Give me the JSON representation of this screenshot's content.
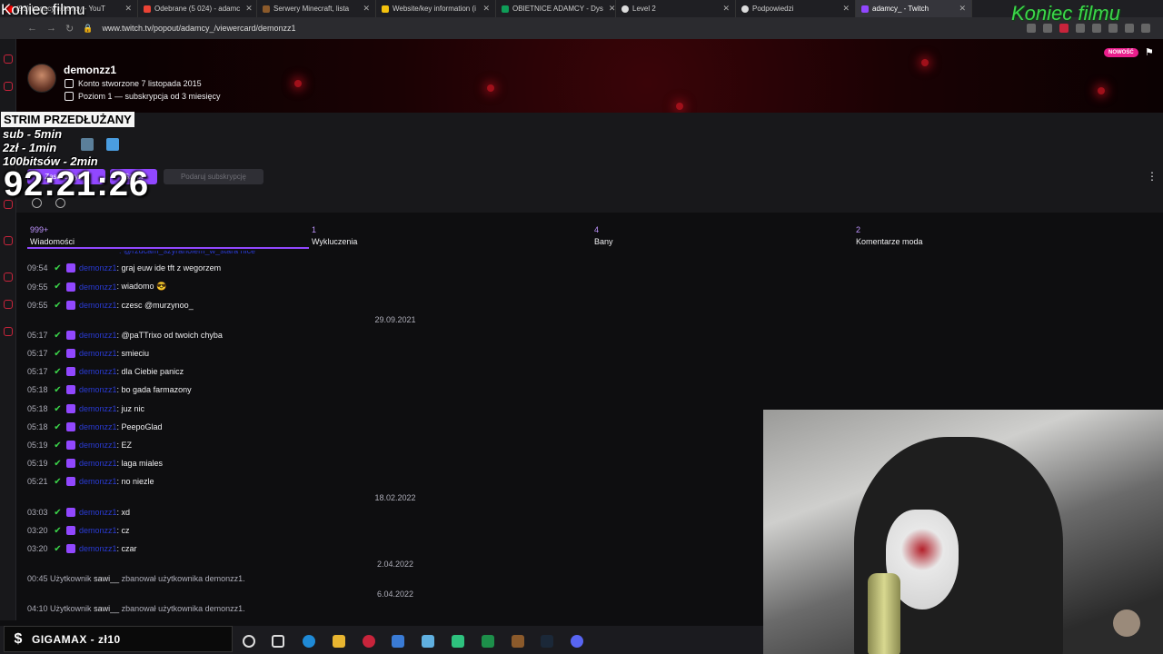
{
  "browser": {
    "tabs": [
      {
        "label": "(92) Legacy adamcy - YouT",
        "color": "#ff0000"
      },
      {
        "label": "Odebrane (5 024) - adamc",
        "color": "#ea4335"
      },
      {
        "label": "Serwery Minecraft, lista",
        "color": "#8b5a2b"
      },
      {
        "label": "Website/key information (i",
        "color": "#f4c20d"
      },
      {
        "label": "OBIETNICE ADAMCY - Dys",
        "color": "#0f9d58"
      },
      {
        "label": "Level 2",
        "color": "#dddddd"
      },
      {
        "label": "Podpowiedzi",
        "color": "#dddddd"
      },
      {
        "label": "adamcy_ - Twitch",
        "color": "#9147ff"
      }
    ],
    "url": "www.twitch.tv/popout/adamcy_/viewercard/demonzz1"
  },
  "overlay": {
    "koniec_left": "Koniec filmu",
    "koniec_right": "Koniec filmu",
    "strim": "STRIM PRZEDŁUŻANY",
    "line1": "sub - 5min",
    "line2": "2zł - 1min",
    "line3": "100bitsów - 2min",
    "timer": "92:21:26"
  },
  "viewer": {
    "username": "demonzz1",
    "account_created": "Konto stworzone 7 listopada 2015",
    "sub_info": "Poziom 1 — subskrypcja od 3 miesięcy",
    "new_badge": "NOWOŚĆ"
  },
  "actions": {
    "follow_label": "Zasubskrybuj",
    "sub_label": "Szept",
    "gift_label": "Podaruj subskrypcję"
  },
  "stats": [
    {
      "num": "999+",
      "label": "Wiadomości"
    },
    {
      "num": "1",
      "label": "Wykluczenia"
    },
    {
      "num": "4",
      "label": "Bany"
    },
    {
      "num": "2",
      "label": "Komentarze moda"
    }
  ],
  "chat": {
    "cut_top": ": @rzucam_szyranolem_w_stara nice",
    "username_hidden": "demonzz1",
    "group1": [
      {
        "time": "09:54",
        "text": ": graj euw ide tft z wegorzem"
      },
      {
        "time": "09:55",
        "text": ": wiadomo 😎"
      },
      {
        "time": "09:55",
        "text": ": czesc @murzynoo_"
      }
    ],
    "date1": "29.09.2021",
    "group2": [
      {
        "time": "05:17",
        "text": ": @paTTrixo od twoich chyba"
      },
      {
        "time": "05:17",
        "text": ": smieciu"
      },
      {
        "time": "05:17",
        "text": ": dla Ciebie panicz"
      },
      {
        "time": "05:18",
        "text": ": bo gada farmazony"
      },
      {
        "time": "05:18",
        "text": ": juz nic"
      },
      {
        "time": "05:18",
        "text": ": PeepoGlad"
      },
      {
        "time": "05:19",
        "text": ": EZ"
      },
      {
        "time": "05:19",
        "text": ": laga miales"
      },
      {
        "time": "05:21",
        "text": ": no niezle"
      }
    ],
    "date2": "18.02.2022",
    "group3": [
      {
        "time": "03:03",
        "text": ": xd"
      },
      {
        "time": "03:20",
        "text": ": cz"
      },
      {
        "time": "03:20",
        "text": ": czar"
      }
    ],
    "date3": "2.04.2022",
    "sys1": {
      "time": "00:45",
      "pre": "Użytkownik ",
      "mod": "sawi__",
      "post": " zbanował użytkownika demonzz1."
    },
    "date4": "6.04.2022",
    "sys2": {
      "time": "04:10",
      "pre": "Użytkownik ",
      "mod": "sawi__",
      "post": " zbanował użytkownika demonzz1."
    }
  },
  "taskbar": {
    "donation_text": "GIGAMAX - zł10"
  }
}
